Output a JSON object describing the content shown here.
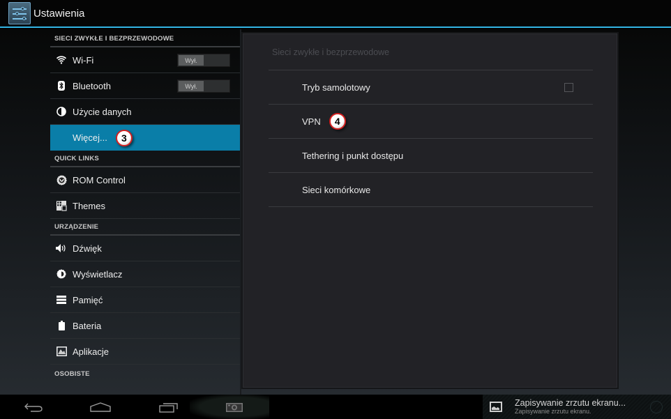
{
  "app": {
    "title": "Ustawienia",
    "icon": "settings-sliders-icon",
    "accent": "#33b5e5"
  },
  "sidebar": {
    "sections": [
      {
        "header": "SIECI ZWYKŁE I BEZPRZEWODOWE",
        "items": [
          {
            "label": "Wi-Fi",
            "icon": "wifi-icon",
            "toggle": "Wył."
          },
          {
            "label": "Bluetooth",
            "icon": "bluetooth-icon",
            "toggle": "Wył."
          },
          {
            "label": "Użycie danych",
            "icon": "data-usage-icon"
          },
          {
            "label": "Więcej...",
            "icon": "",
            "selected": true,
            "badge": "3"
          }
        ]
      },
      {
        "header": "QUICK LINKS",
        "items": [
          {
            "label": "ROM Control",
            "icon": "rom-control-icon"
          },
          {
            "label": "Themes",
            "icon": "themes-icon"
          }
        ]
      },
      {
        "header": "URZĄDZENIE",
        "items": [
          {
            "label": "Dźwięk",
            "icon": "sound-icon"
          },
          {
            "label": "Wyświetlacz",
            "icon": "display-icon"
          },
          {
            "label": "Pamięć",
            "icon": "storage-icon"
          },
          {
            "label": "Bateria",
            "icon": "battery-icon"
          },
          {
            "label": "Aplikacje",
            "icon": "apps-icon"
          }
        ]
      },
      {
        "header": "OSOBISTE",
        "items": []
      }
    ],
    "selected_color": "#0a7ea8"
  },
  "detail": {
    "title": "Sieci zwykłe i bezprzewodowe",
    "items": [
      {
        "label": "Tryb samolotowy",
        "checkbox": false
      },
      {
        "label": "VPN",
        "badge": "4"
      },
      {
        "label": "Tethering i punkt dostępu"
      },
      {
        "label": "Sieci komórkowe"
      }
    ]
  },
  "navbar": {
    "buttons": [
      "back-icon",
      "home-icon",
      "recent-apps-icon",
      "screenshot-icon"
    ]
  },
  "notification": {
    "title": "Zapisywanie zrzutu ekranu...",
    "subtitle": "Zapisywanie zrzutu ekranu.",
    "icon": "image-icon"
  }
}
